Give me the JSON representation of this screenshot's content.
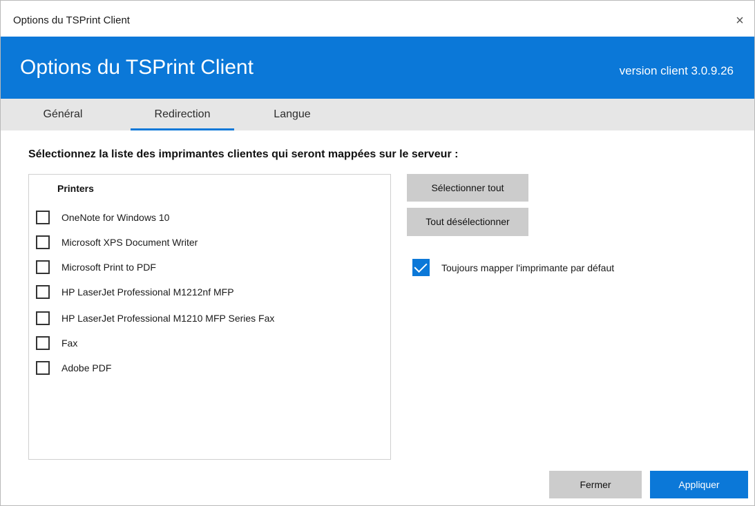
{
  "window": {
    "title": "Options du TSPrint Client",
    "close_glyph": "×"
  },
  "banner": {
    "heading": "Options du TSPrint Client",
    "version": "version client 3.0.9.26",
    "color": "#0b78d8"
  },
  "tabs": [
    {
      "label": "Général",
      "active": false
    },
    {
      "label": "Redirection",
      "active": true
    },
    {
      "label": "Langue",
      "active": false
    }
  ],
  "main": {
    "instruction": "Sélectionnez la liste des imprimantes clientes qui seront mappées sur le serveur :",
    "printers_header": "Printers",
    "printers": [
      {
        "label": "OneNote for Windows 10",
        "checked": false
      },
      {
        "label": "Microsoft XPS Document Writer",
        "checked": false
      },
      {
        "label": "Microsoft Print to PDF",
        "checked": false
      },
      {
        "label": "HP LaserJet Professional M1212nf MFP",
        "checked": false
      },
      {
        "label": "HP LaserJet Professional M1210 MFP Series Fax",
        "checked": false
      },
      {
        "label": "Fax",
        "checked": false
      },
      {
        "label": "Adobe PDF",
        "checked": false
      }
    ],
    "select_all_label": "Sélectionner tout",
    "deselect_all_label": "Tout désélectionner",
    "always_map_default": {
      "label": "Toujours mapper l'imprimante par défaut",
      "checked": true
    }
  },
  "footer": {
    "close_label": "Fermer",
    "apply_label": "Appliquer"
  }
}
